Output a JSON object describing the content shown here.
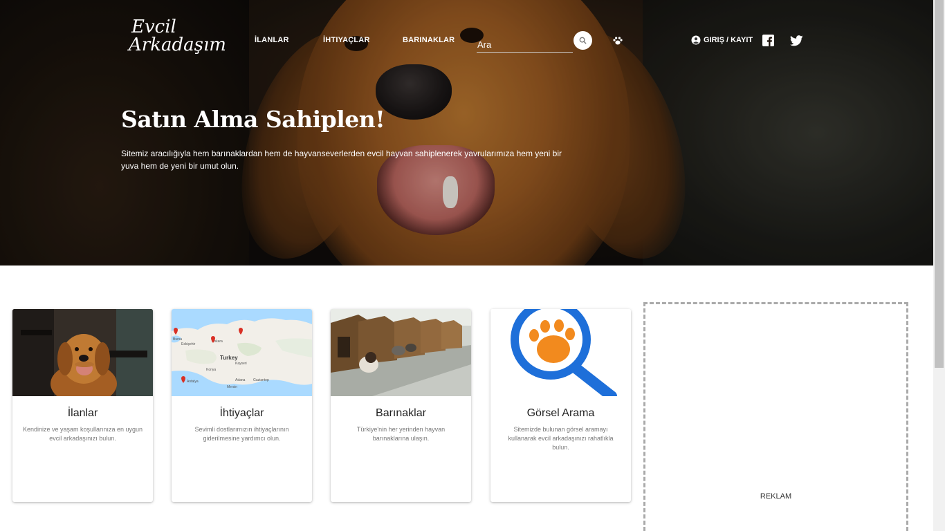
{
  "header": {
    "logo_line1": "Evcil",
    "logo_line2": "Arkadaşım",
    "nav": [
      {
        "label": "İLANLAR"
      },
      {
        "label": "İHTIYAÇLAR"
      },
      {
        "label": "BARINAKLAR"
      }
    ],
    "search": {
      "placeholder": "Ara"
    },
    "login_label": "GIRIŞ / KAYIT"
  },
  "hero": {
    "title": "Satın Alma Sahiplen!",
    "description": "Sitemiz aracılığıyla hem barınaklardan hem de hayvanseverlerden evcil hayvan sahiplenerek yavrularımıza hem yeni bir yuva hem de yeni bir umut olun."
  },
  "cards": [
    {
      "title": "İlanlar",
      "text": "Kendinize ve yaşam koşullarınıza en uygun evcil arkadaşınızı bulun.",
      "image": "golden-retriever-photo"
    },
    {
      "title": "İhtiyaçlar",
      "text": "Sevimli dostlarımızın ihtiyaçlarının giderilmesine yardımcı olun.",
      "image": "turkey-map-image"
    },
    {
      "title": "Barınaklar",
      "text": "Türkiye'nin her yerinden hayvan barınaklarına ulaşın.",
      "image": "shelter-dogs-photo"
    },
    {
      "title": "Görsel Arama",
      "text": "Sitemizde bulunan görsel aramayı kullanarak evcil arkadaşınızı rahatlıkla bulun.",
      "image": "paw-magnifier-icon"
    }
  ],
  "map_labels": {
    "country": "Turkey",
    "cities": [
      "Bursa",
      "Eskişehir",
      "Ankara",
      "Kayseri",
      "Konya",
      "Adana",
      "Gaziantep",
      "Antalya",
      "Mersin"
    ]
  },
  "ad": {
    "label": "REKLAM"
  },
  "colors": {
    "primary_text": "#222222",
    "muted_text": "#777777",
    "search_blue": "#1e6fd9",
    "paw_orange": "#f28a1e"
  }
}
